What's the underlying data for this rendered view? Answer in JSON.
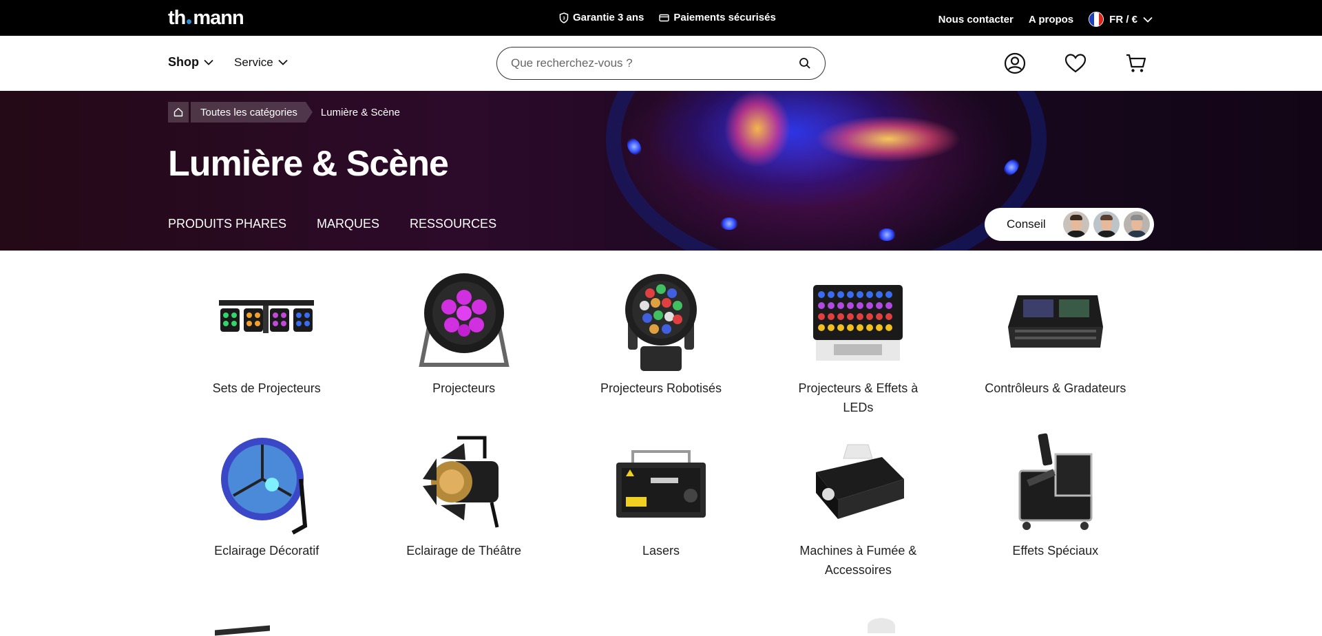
{
  "topbar": {
    "logo": {
      "part1": "th",
      "part2": "mann"
    },
    "guarantee": "Garantie 3 ans",
    "payments": "Paiements sécurisés",
    "contact": "Nous contacter",
    "about": "A propos",
    "language": "FR / €"
  },
  "header": {
    "shop": "Shop",
    "service": "Service",
    "search_placeholder": "Que recherchez-vous ?"
  },
  "hero": {
    "breadcrumb": [
      "Toutes les catégories",
      "Lumière & Scène"
    ],
    "title": "Lumière & Scène",
    "tabs": [
      "PRODUITS PHARES",
      "MARQUES",
      "RESSOURCES"
    ],
    "conseil": "Conseil"
  },
  "categories": [
    "Sets de Projecteurs",
    "Projecteurs",
    "Projecteurs Robotisés",
    "Projecteurs & Effets à LEDs",
    "Contrôleurs & Gradateurs",
    "Eclairage Décoratif",
    "Eclairage de Théâtre",
    "Lasers",
    "Machines à Fumée & Accessoires",
    "Effets Spéciaux"
  ],
  "colors": {
    "topbar_bg": "#000000",
    "accent_dot": "#2b8fd6",
    "hero_bg": "#240916"
  },
  "icons": [
    "shield-icon",
    "card-icon",
    "user-icon",
    "heart-icon",
    "cart-icon",
    "search-icon",
    "home-icon",
    "chevron-down-icon"
  ]
}
